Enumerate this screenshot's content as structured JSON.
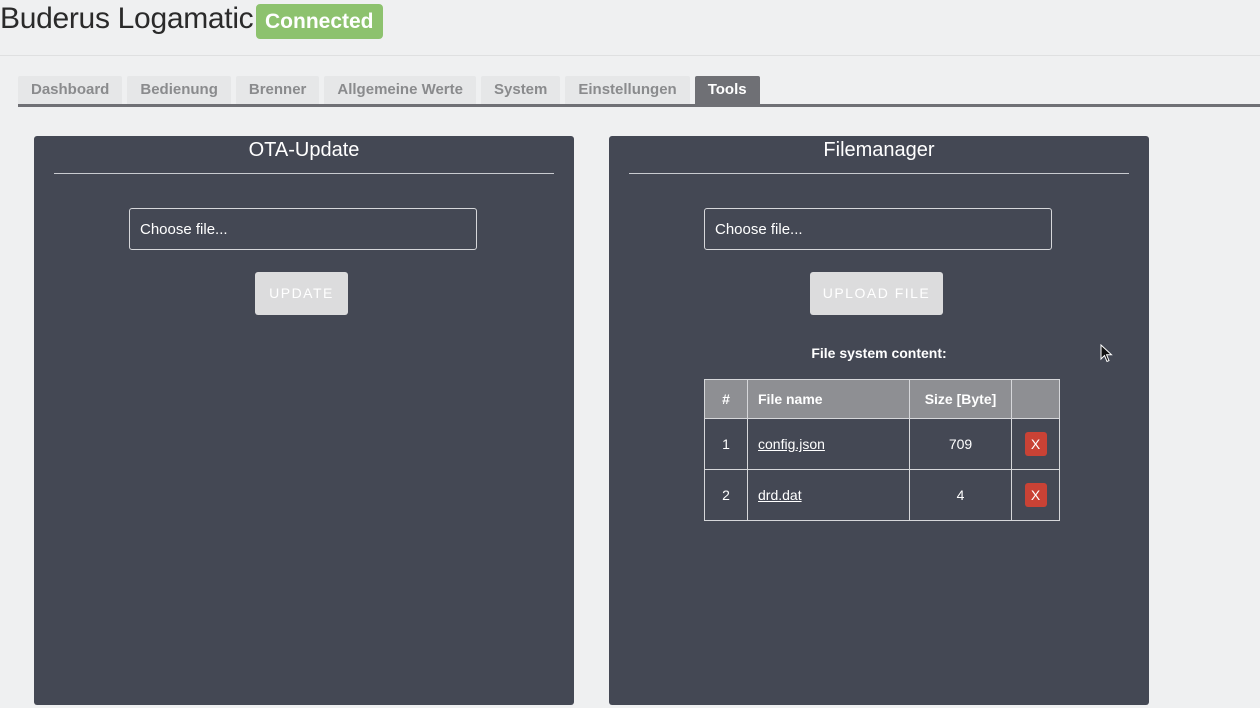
{
  "app": {
    "title": "Buderus Logamatic",
    "status": "Connected"
  },
  "tabs": [
    {
      "label": "Dashboard"
    },
    {
      "label": "Bedienung"
    },
    {
      "label": "Brenner"
    },
    {
      "label": "Allgemeine Werte"
    },
    {
      "label": "System"
    },
    {
      "label": "Einstellungen"
    },
    {
      "label": "Tools",
      "active": true
    }
  ],
  "ota": {
    "title": "OTA-Update",
    "file_placeholder": "Choose file...",
    "button": "UPDATE"
  },
  "filemanager": {
    "title": "Filemanager",
    "file_placeholder": "Choose file...",
    "button": "UPLOAD FILE",
    "fs_label": "File system content:",
    "columns": [
      "#",
      "File name",
      "Size [Byte]",
      ""
    ],
    "rows": [
      {
        "index": "1",
        "name": "config.json",
        "size": "709",
        "delete": "X"
      },
      {
        "index": "2",
        "name": "drd.dat",
        "size": "4",
        "delete": "X"
      }
    ]
  },
  "colors": {
    "accent_connected": "#8dc26e",
    "card_bg": "#444854",
    "delete": "#c94235"
  }
}
